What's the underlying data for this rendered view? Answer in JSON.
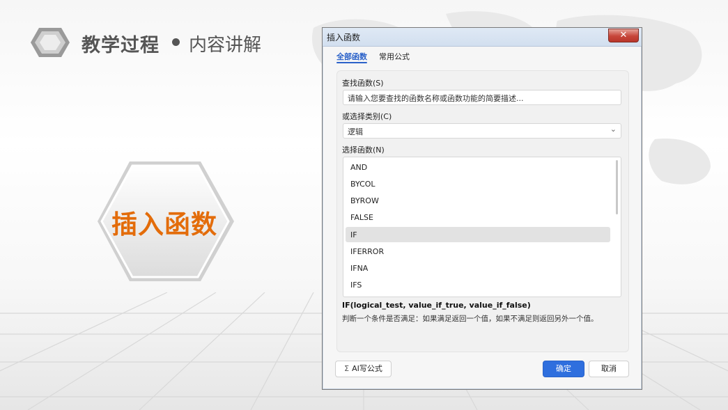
{
  "slide": {
    "title_main": "教学过程",
    "title_sub": "内容讲解",
    "hex_label": "插入函数",
    "accent_color": "#e36c0a"
  },
  "dialog": {
    "title": "插入函数",
    "close_icon": "close-icon",
    "tabs": [
      {
        "label": "全部函数",
        "active": true
      },
      {
        "label": "常用公式",
        "active": false
      }
    ],
    "search": {
      "label": "查找函数(S)",
      "placeholder": "请输入您要查找的函数名称或函数功能的简要描述..."
    },
    "category": {
      "label": "或选择类别(C)",
      "value": "逻辑"
    },
    "function_list": {
      "label": "选择函数(N)",
      "items": [
        "AND",
        "BYCOL",
        "BYROW",
        "FALSE",
        "IF",
        "IFERROR",
        "IFNA",
        "IFS"
      ],
      "selected": "IF"
    },
    "signature": "IF(logical_test, value_if_true, value_if_false)",
    "description": "判断一个条件是否满足：如果满足返回一个值，如果不满足则返回另外一个值。",
    "buttons": {
      "ai": "AI写公式",
      "ok": "确定",
      "cancel": "取消"
    },
    "primary_color": "#2f6fde"
  }
}
